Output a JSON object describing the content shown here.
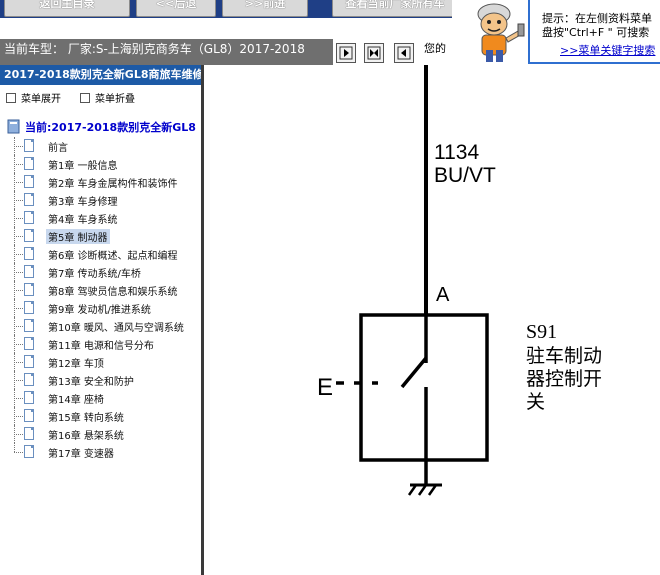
{
  "toolbar": {
    "buttons": [
      {
        "label": "返回主目录"
      },
      {
        "label": "<<后退"
      },
      {
        "label": ">>前进"
      },
      {
        "label": "查看当前厂家所有车"
      }
    ]
  },
  "hint": {
    "line1": "提示：在左侧资料菜单",
    "line2": "盘按\"Ctrl+F \" 可搜索",
    "link": ">>菜单关键字搜索"
  },
  "model_bar": {
    "text": "当前车型：  厂家:S-上海别克商务车（GL8）2017-2018"
  },
  "right_tab_text": "您的",
  "left_panel": {
    "header": "2017-2018款别克全新GL8商旅车维修",
    "expand_label": "菜单展开",
    "collapse_label": "菜单折叠",
    "root_label": "当前:2017-2018款别克全新GL8",
    "items": [
      {
        "label": "前言"
      },
      {
        "label": "第1章 一般信息"
      },
      {
        "label": "第2章 车身金属构件和装饰件"
      },
      {
        "label": "第3章 车身修理"
      },
      {
        "label": "第4章 车身系统"
      },
      {
        "label": "第5章 制动器"
      },
      {
        "label": "第6章 诊断概述、起点和编程"
      },
      {
        "label": "第7章 传动系统/车桥"
      },
      {
        "label": "第8章 驾驶员信息和娱乐系统"
      },
      {
        "label": "第9章 发动机/推进系统"
      },
      {
        "label": "第10章 暖风、通风与空调系统"
      },
      {
        "label": "第11章 电源和信号分布"
      },
      {
        "label": "第12章 车顶"
      },
      {
        "label": "第13章 安全和防护"
      },
      {
        "label": "第14章 座椅"
      },
      {
        "label": "第15章 转向系统"
      },
      {
        "label": "第16章 悬架系统"
      },
      {
        "label": "第17章 变速器"
      }
    ],
    "selected_index": 5
  },
  "diagram": {
    "wire_number": "1134",
    "wire_color": "BU/VT",
    "pin_label": "A",
    "component_id": "S91",
    "component_name_line1": "驻车制动",
    "component_name_line2": "器控制开",
    "component_name_line3": "关",
    "input_label": "E"
  }
}
